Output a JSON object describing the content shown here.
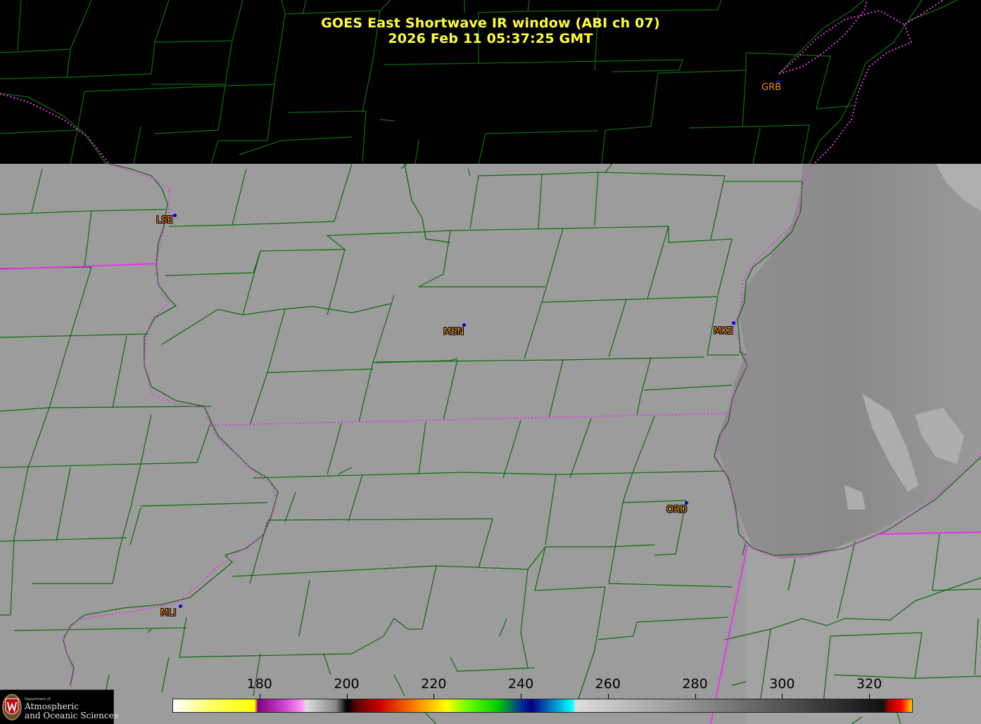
{
  "title": {
    "line1": "GOES East Shortwave IR window (ABI ch 07)",
    "line2": "2026 Feb 11  05:37:25 GMT"
  },
  "cities": [
    {
      "code": "GRB",
      "style": "plain"
    },
    {
      "code": "LSE",
      "style": "outlined"
    },
    {
      "code": "MSN",
      "style": "outlined"
    },
    {
      "code": "MKE",
      "style": "outlined"
    },
    {
      "code": "ORD",
      "style": "outlined"
    },
    {
      "code": "MLI",
      "style": "outlined"
    }
  ],
  "colorbar": {
    "units_min": 160,
    "units_max": 330,
    "ticks": [
      "180",
      "200",
      "220",
      "240",
      "260",
      "280",
      "300",
      "320"
    ]
  },
  "colors": {
    "county_lines": "#0a6e0a",
    "state_borders": "#ee33ee",
    "title_text": "#ffff33",
    "city_label": "#f08a22",
    "city_dot": "#0000ee",
    "cloud_free_gray": "#9b9b9b",
    "no_data": "#000000"
  },
  "logo": {
    "dept": "Department of",
    "line1": "Atmospheric",
    "line2": "and Oceanic Sciences"
  }
}
